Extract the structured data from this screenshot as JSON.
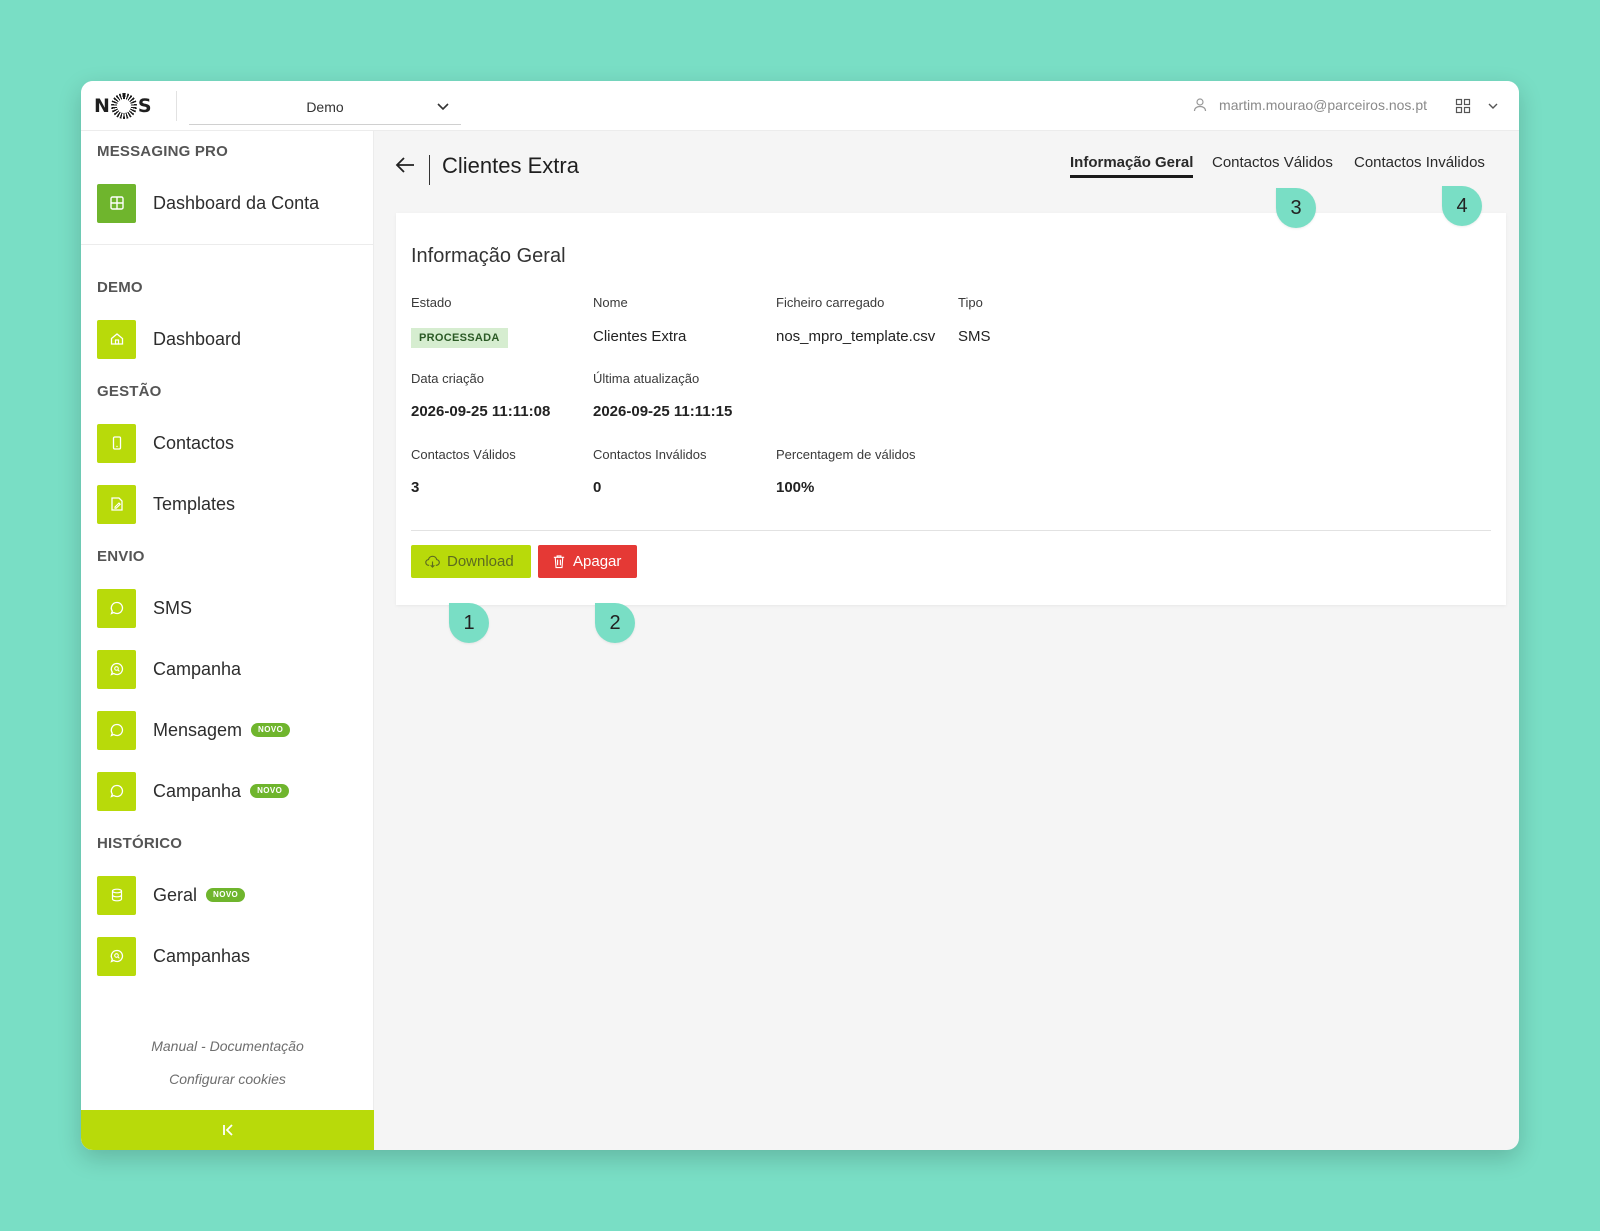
{
  "header": {
    "logo_text": "NOS",
    "workspace": "Demo",
    "user_email": "martim.mourao@parceiros.nos.pt"
  },
  "sidebar": {
    "sections": {
      "messaging_pro": "MESSAGING PRO",
      "demo": "DEMO",
      "gestao": "GESTÃO",
      "envio": "ENVIO",
      "historico": "HISTÓRICO"
    },
    "items": {
      "dashboard_conta": "Dashboard da Conta",
      "dashboard": "Dashboard",
      "contactos": "Contactos",
      "templates": "Templates",
      "sms": "SMS",
      "campanha": "Campanha",
      "mensagem": "Mensagem",
      "campanha_novo": "Campanha",
      "geral": "Geral",
      "campanhas": "Campanhas"
    },
    "badge_novo": "NOVO",
    "footer": {
      "manual": "Manual - Documentação",
      "cookies": "Configurar cookies"
    },
    "collapse_glyph": "⇤"
  },
  "main": {
    "title": "Clientes Extra",
    "tabs": [
      "Informação Geral",
      "Contactos Válidos",
      "Contactos Inválidos"
    ],
    "card": {
      "title": "Informação Geral",
      "labels": {
        "estado": "Estado",
        "nome": "Nome",
        "ficheiro": "Ficheiro carregado",
        "tipo": "Tipo",
        "data_criacao": "Data criação",
        "ultima_atualizacao": "Última atualização",
        "contactos_validos": "Contactos Válidos",
        "contactos_invalidos": "Contactos Inválidos",
        "percentagem": "Percentagem de válidos"
      },
      "values": {
        "estado": "PROCESSADA",
        "nome": "Clientes Extra",
        "ficheiro": "nos_mpro_template.csv",
        "tipo": "SMS",
        "data_criacao": "2026-09-25 11:11:08",
        "ultima_atualizacao": "2026-09-25 11:11:15",
        "contactos_validos": "3",
        "contactos_invalidos": "0",
        "percentagem": "100%"
      },
      "buttons": {
        "download": "Download",
        "apagar": "Apagar"
      }
    }
  },
  "callouts": [
    "1",
    "2",
    "3",
    "4"
  ],
  "colors": {
    "background": "#79dec5",
    "accent_lime": "#b8da0a",
    "accent_green": "#6fb52d",
    "danger": "#e53935",
    "status_bg": "#d6edd0"
  }
}
